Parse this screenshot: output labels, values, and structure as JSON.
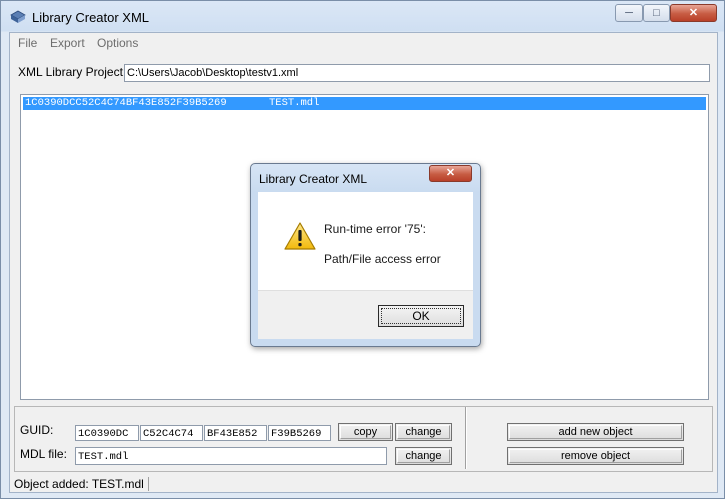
{
  "window": {
    "title": "Library Creator XML",
    "minimize": "─",
    "maximize": "□",
    "close": "✕"
  },
  "menu": [
    "File",
    "Export",
    "Options"
  ],
  "project": {
    "label": "XML Library Project:",
    "path": "C:\\Users\\Jacob\\Desktop\\testv1.xml"
  },
  "objects": [
    {
      "guid": "1C0390DCC52C4C74BF43E852F39B5269",
      "file": "TEST.mdl",
      "selected": true
    }
  ],
  "guid": {
    "label": "GUID:",
    "parts": [
      "1C0390DC",
      "C52C4C74",
      "BF43E852",
      "F39B5269"
    ]
  },
  "mdl": {
    "label": "MDL file:",
    "value": "TEST.mdl"
  },
  "buttons": {
    "copy": "copy",
    "change_guid": "change",
    "change_mdl": "change",
    "add_object": "add new object",
    "remove_object": "remove object"
  },
  "status": "Object added: TEST.mdl",
  "dialog": {
    "title": "Library Creator XML",
    "close": "✕",
    "message_line1": "Run-time error '75':",
    "message_line2": "Path/File access error",
    "ok": "OK",
    "icon": "warning-icon"
  },
  "colors": {
    "selection": "#3399ff",
    "close_button": "#c75c43"
  }
}
